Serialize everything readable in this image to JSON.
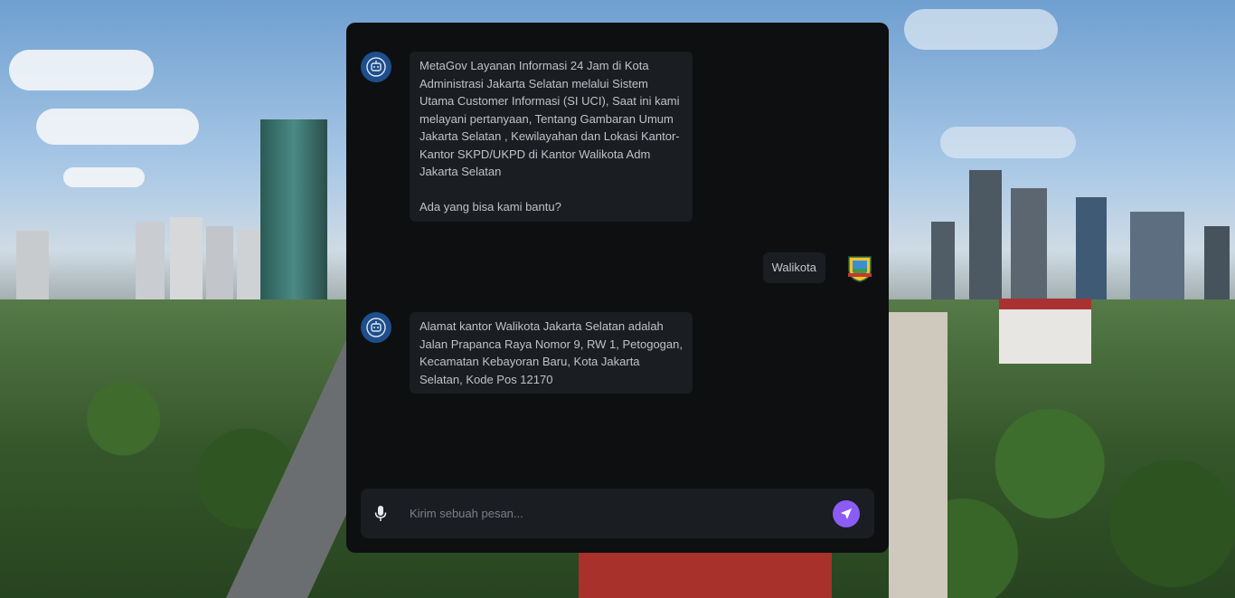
{
  "chat": {
    "messages": [
      {
        "sender": "bot",
        "paragraphs": [
          "MetaGov Layanan Informasi 24 Jam di Kota Administrasi Jakarta Selatan melalui Sistem Utama Customer Informasi (SI UCI), Saat ini kami melayani pertanyaan, Tentang Gambaran Umum Jakarta Selatan , Kewilayahan dan Lokasi Kantor-Kantor SKPD/UKPD di Kantor Walikota Adm Jakarta Selatan",
          "Ada yang bisa kami bantu?"
        ]
      },
      {
        "sender": "user",
        "text": "Walikota"
      },
      {
        "sender": "bot",
        "paragraphs": [
          "Alamat kantor Walikota Jakarta Selatan adalah Jalan Prapanca Raya Nomor 9, RW 1, Petogogan, Kecamatan Kebayoran Baru, Kota Jakarta Selatan, Kode Pos 12170"
        ]
      }
    ]
  },
  "input": {
    "placeholder": "Kirim sebuah pesan...",
    "value": ""
  },
  "icons": {
    "bot_avatar": "robot-icon",
    "user_avatar": "emblem-icon",
    "mic": "microphone-icon",
    "send": "send-icon"
  },
  "colors": {
    "panel_bg": "#0d0f11",
    "bubble_bg": "#1a1d21",
    "accent": "#8b5cf6",
    "bot_avatar": "#1e4e8c"
  }
}
